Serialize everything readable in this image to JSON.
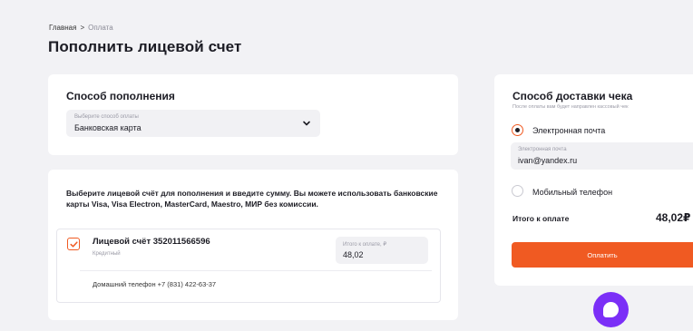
{
  "breadcrumb": {
    "home": "Главная",
    "separator": ">",
    "current": "Оплата"
  },
  "page": {
    "title": "Пополнить лицевой счет"
  },
  "payment_method": {
    "heading": "Способ пополнения",
    "select_hint": "Выберите способ оплаты",
    "select_value": "Банковская карта",
    "chevron_icon": "chevron-down-icon"
  },
  "account_section": {
    "description": "Выберите лицевой счёт для пополнения и введите сумму. Вы можете использовать банковские карты Visa, Visa Electron, MasterCard, Maestro, МИР без комиссии.",
    "account": {
      "checked": true,
      "title": "Лицевой счёт 352011566596",
      "subtitle": "Кредитный",
      "sum_hint": "Итого к оплате, ₽",
      "sum_value": "48,02",
      "phone": "Домашний телефон +7 (831) 422-63-37"
    }
  },
  "receipt_delivery": {
    "heading": "Способ доставки чека",
    "subtitle": "После оплаты вам будет направлен кассовый чек",
    "options": [
      {
        "label": "Электронная почта",
        "selected": true
      },
      {
        "label": "Мобильный телефон",
        "selected": false
      }
    ],
    "email_hint": "Электронная почта",
    "email_value": "ivan@yandex.ru",
    "total_label": "Итого к оплате",
    "total_value": "48,02₽",
    "pay_button": "Оплатить"
  },
  "colors": {
    "accent": "#f05a22",
    "chat": "#7b2ff7",
    "background": "#f2f2f5"
  },
  "chat_icon": "chat-bubble-icon"
}
